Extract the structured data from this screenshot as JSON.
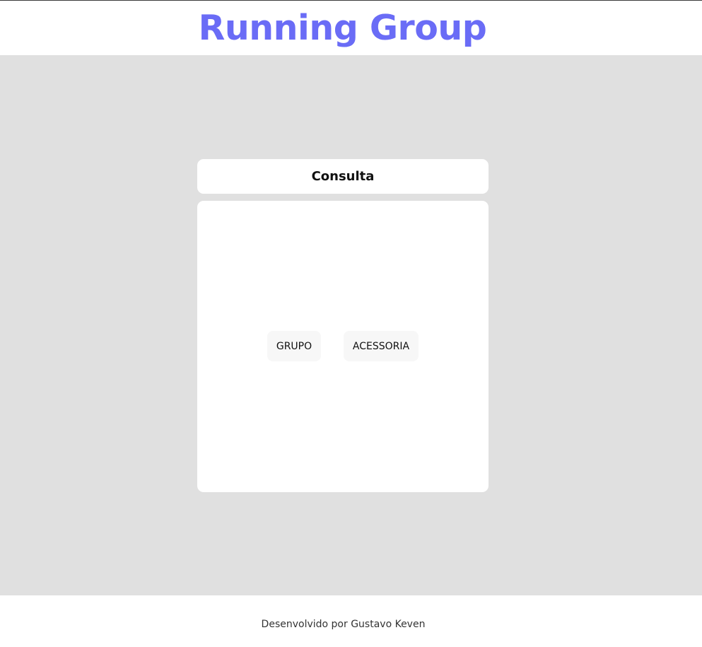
{
  "header": {
    "title": "Running Group"
  },
  "consulta": {
    "title": "Consulta",
    "buttons": {
      "grupo": "GRUPO",
      "acessoria": "ACESSORIA"
    }
  },
  "footer": {
    "text": "Desenvolvido por Gustavo Keven"
  },
  "colors": {
    "accent": "#6a6cf6",
    "background": "#e0e0e0",
    "card": "#ffffff",
    "button": "#f7f7f7"
  }
}
